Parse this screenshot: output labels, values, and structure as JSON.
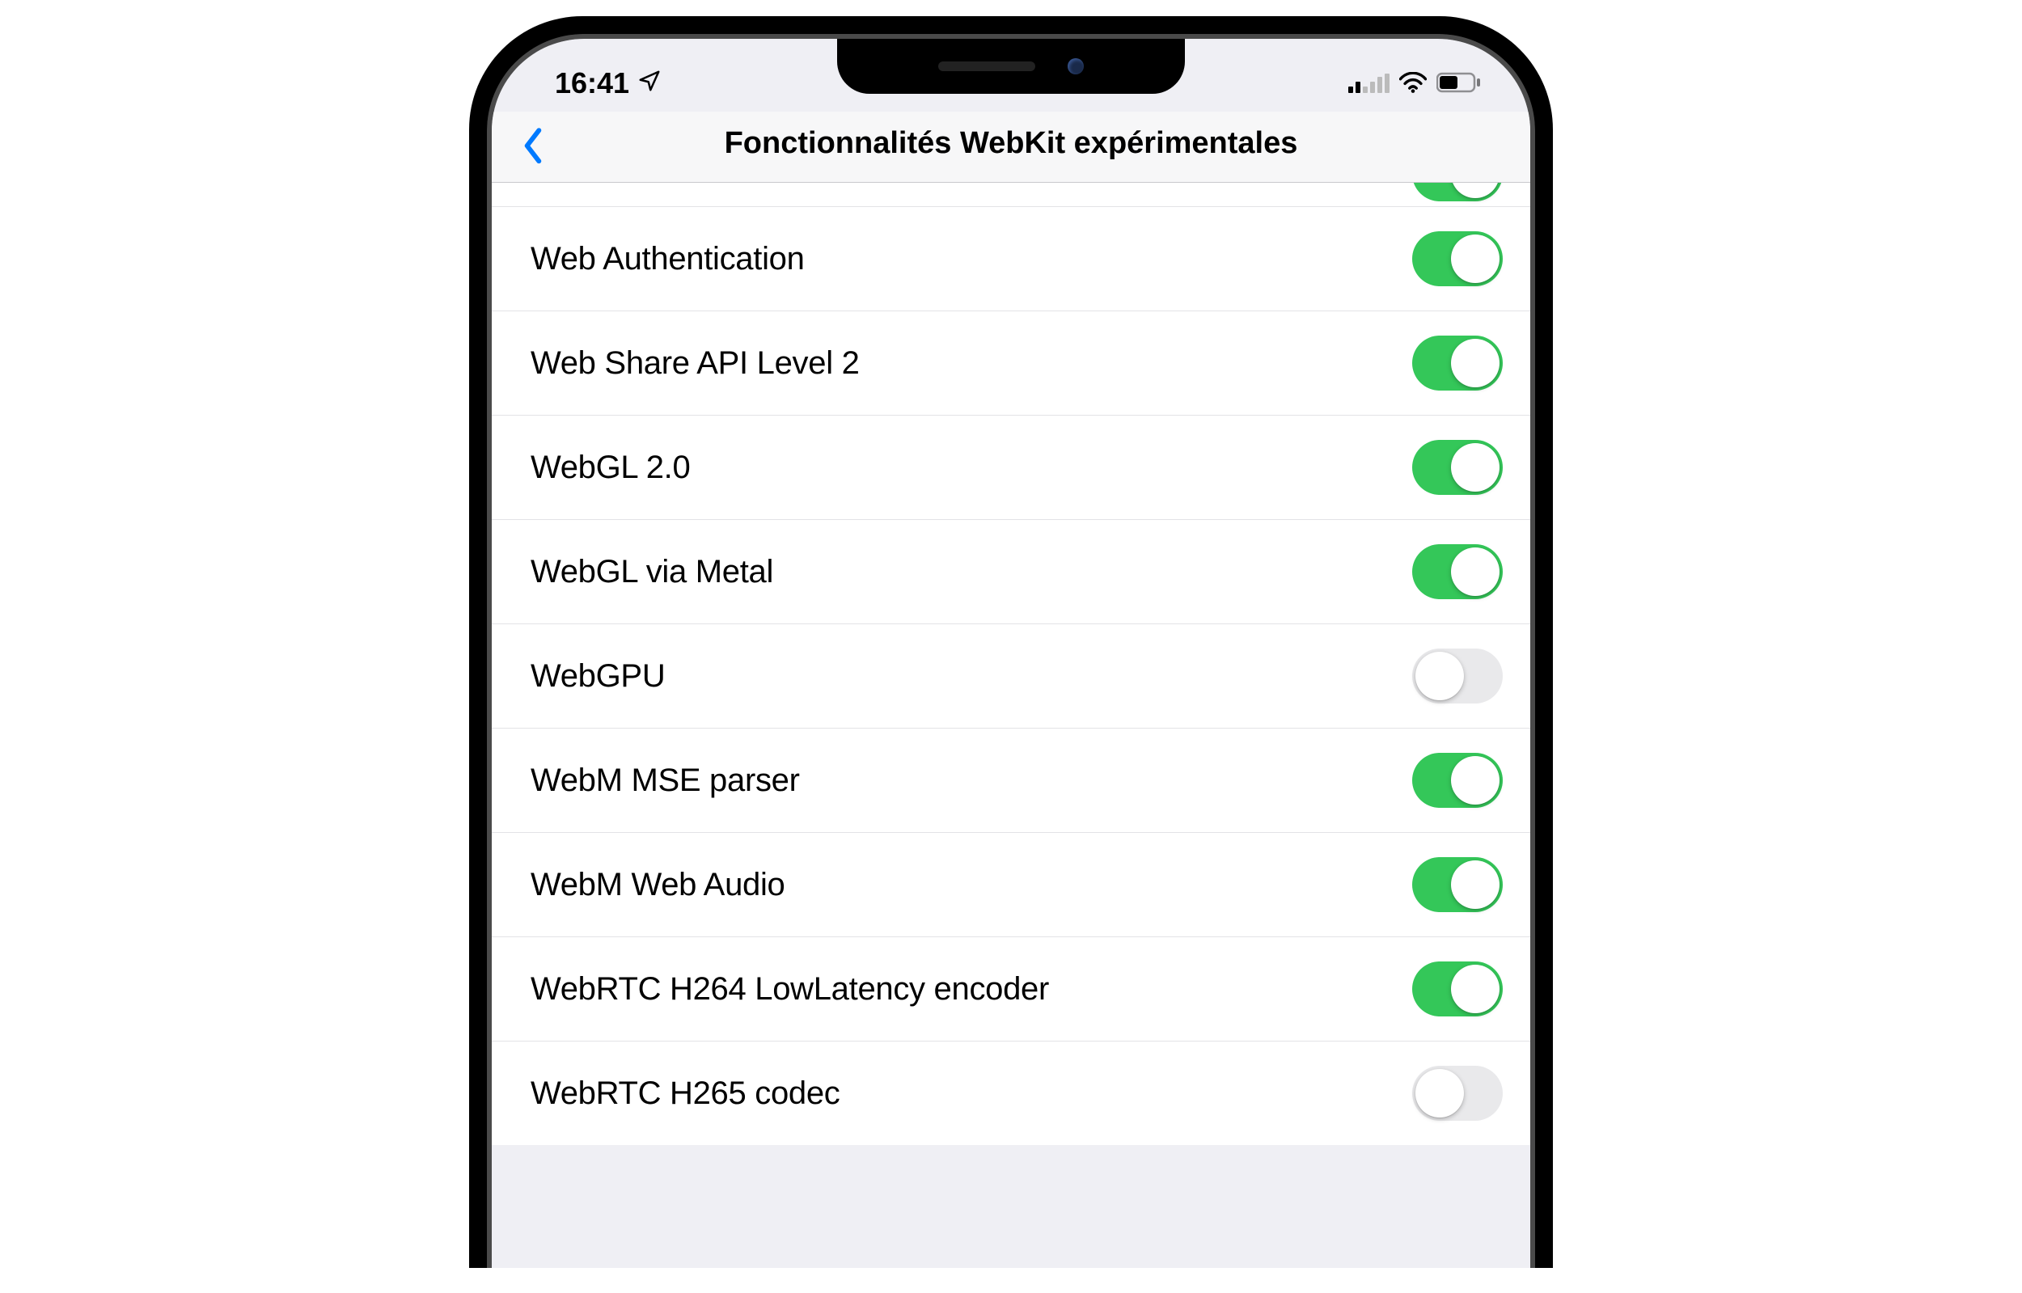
{
  "status_bar": {
    "time": "16:41"
  },
  "nav": {
    "title": "Fonctionnalités WebKit expérimentales"
  },
  "settings": [
    {
      "label": "Web Authentication",
      "enabled": true
    },
    {
      "label": "Web Share API Level 2",
      "enabled": true
    },
    {
      "label": "WebGL 2.0",
      "enabled": true
    },
    {
      "label": "WebGL via Metal",
      "enabled": true
    },
    {
      "label": "WebGPU",
      "enabled": false
    },
    {
      "label": "WebM MSE parser",
      "enabled": true
    },
    {
      "label": "WebM Web Audio",
      "enabled": true
    },
    {
      "label": "WebRTC H264 LowLatency encoder",
      "enabled": true
    },
    {
      "label": "WebRTC H265 codec",
      "enabled": false
    }
  ]
}
